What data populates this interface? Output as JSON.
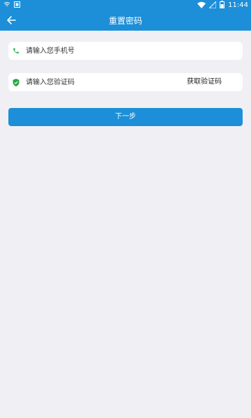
{
  "status_bar": {
    "time": "11:44",
    "left_icons": [
      "notification-icon",
      "download-icon"
    ],
    "right_icons": [
      "wifi-icon",
      "signal-icon",
      "battery-icon"
    ]
  },
  "header": {
    "title": "重置密码",
    "back_icon": "arrow-left-icon",
    "background_color": "#1c8fd8"
  },
  "form": {
    "phone": {
      "icon": "phone-icon",
      "icon_color": "#27a844",
      "value": "",
      "placeholder": "请输入您手机号"
    },
    "code": {
      "icon": "shield-check-icon",
      "icon_color": "#27a844",
      "value": "",
      "placeholder": "请输入您验证码",
      "get_code_label": "获取验证码"
    },
    "next_button_label": "下一步"
  },
  "colors": {
    "primary": "#1c8fd8",
    "background": "#efeff4"
  }
}
